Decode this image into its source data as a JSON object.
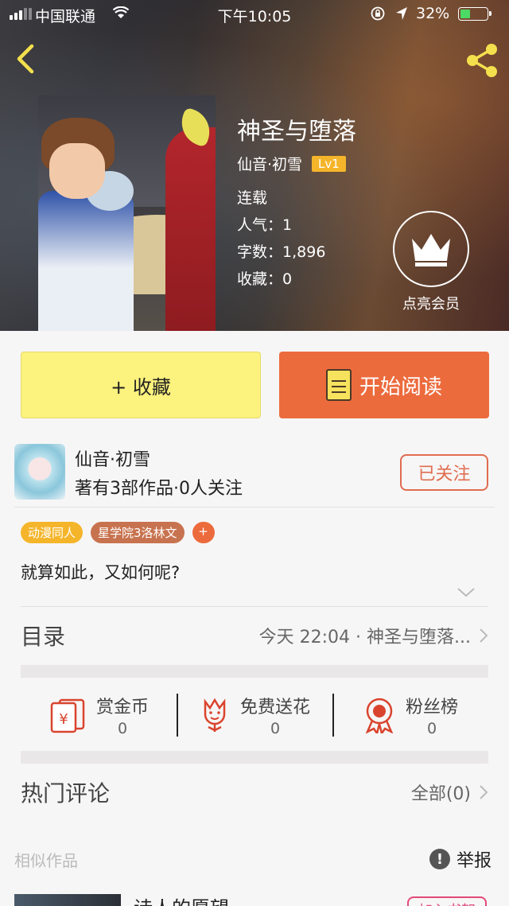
{
  "status_bar": {
    "carrier": "中国联通",
    "time": "下午10:05",
    "battery": "32%"
  },
  "work": {
    "title": "神圣与堕落",
    "author": "仙音·初雪",
    "level": "Lv1",
    "state": "连载",
    "popularity_label": "人气：",
    "popularity": "1",
    "words_label": "字数：",
    "words": "1,896",
    "favorites_label": "收藏：",
    "favorites": "0"
  },
  "vip": {
    "label": "点亮会员",
    "icon": "crown-icon"
  },
  "actions": {
    "favorite": "+ 收藏",
    "read": "开始阅读"
  },
  "author_info": {
    "name": "仙音·初雪",
    "summary": "著有3部作品·0人关注",
    "follow": "已关注"
  },
  "tags": [
    "动漫同人",
    "星学院3洛林文",
    "+"
  ],
  "intro": "就算如此，又如何呢?",
  "toc": {
    "label": "目录",
    "latest": "今天 22:04 · 神圣与堕落..."
  },
  "stats": [
    {
      "label": "赏金币",
      "value": "0",
      "icon": "red-envelope-icon"
    },
    {
      "label": "免费送花",
      "value": "0",
      "icon": "flower-icon"
    },
    {
      "label": "粉丝榜",
      "value": "0",
      "icon": "medal-icon"
    }
  ],
  "comments": {
    "label": "热门评论",
    "all": "全部(0)"
  },
  "similar": {
    "label": "相似作品",
    "report": "举报",
    "first_item_title": "诗人的愿望",
    "add_to_shelf": "加入书架"
  },
  "colors": {
    "favorite_bg": "#fcf27e",
    "read_bg": "#ec6b3d",
    "level_badge": "#f5b52a",
    "follow": "#e06c50",
    "stat_icon": "#d9442e"
  }
}
